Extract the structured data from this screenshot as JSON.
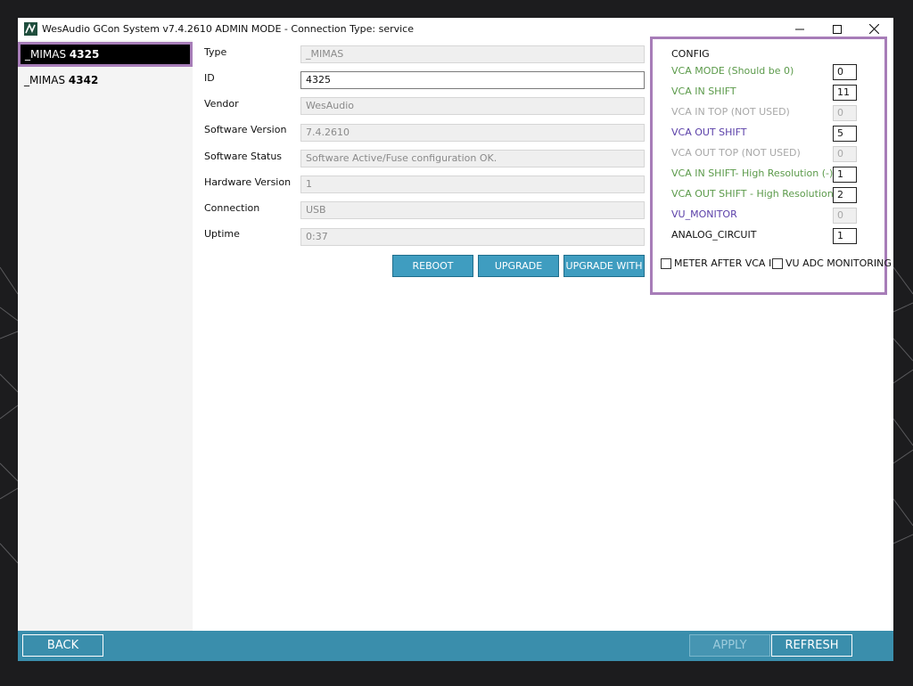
{
  "window": {
    "title": "WesAudio GCon System v7.4.2610 ADMIN MODE - Connection Type: service",
    "minimize_icon": "minimize-icon",
    "maximize_icon": "maximize-icon",
    "close_icon": "close-icon"
  },
  "sidebar": {
    "items": [
      {
        "prefix": "_MIMAS ",
        "id": "4325",
        "selected": true
      },
      {
        "prefix": "_MIMAS ",
        "id": "4342",
        "selected": false
      }
    ]
  },
  "info": {
    "fields": [
      {
        "label": "Type",
        "value": "_MIMAS",
        "editable": false
      },
      {
        "label": "ID",
        "value": "4325",
        "editable": true
      },
      {
        "label": "Vendor",
        "value": "WesAudio",
        "editable": false
      },
      {
        "label": "Software Version",
        "value": "7.4.2610",
        "editable": false
      },
      {
        "label": "Software Status",
        "value": "Software Active/Fuse configuration OK.",
        "editable": false
      },
      {
        "label": "Hardware Version",
        "value": "1",
        "editable": false
      },
      {
        "label": "Connection",
        "value": "USB",
        "editable": false
      },
      {
        "label": "Uptime",
        "value": "0:37",
        "editable": false
      }
    ],
    "buttons": {
      "reboot": "REBOOT",
      "upgrade": "UPGRADE",
      "upgrade_with": "UPGRADE WITH"
    }
  },
  "config": {
    "title": "CONFIG",
    "rows": [
      {
        "label": "VCA MODE (Should be 0)",
        "value": "0",
        "color": "#5b9a4a",
        "enabled": true
      },
      {
        "label": "VCA IN SHIFT",
        "value": "11",
        "color": "#5b9a4a",
        "enabled": true
      },
      {
        "label": "VCA IN TOP (NOT USED)",
        "value": "0",
        "color": "#a8a8a8",
        "enabled": false
      },
      {
        "label": "VCA OUT SHIFT",
        "value": "5",
        "color": "#5a3fa8",
        "enabled": true
      },
      {
        "label": "VCA OUT TOP (NOT USED)",
        "value": "0",
        "color": "#a8a8a8",
        "enabled": false
      },
      {
        "label": "VCA IN SHIFT- High Resolution (-)",
        "value": "1",
        "color": "#5b9a4a",
        "enabled": true
      },
      {
        "label": "VCA OUT SHIFT - High Resolution (-)",
        "value": "2",
        "color": "#5b9a4a",
        "enabled": true
      },
      {
        "label": "VU_MONITOR",
        "value": "0",
        "color": "#5a3fa8",
        "enabled": false
      },
      {
        "label": "ANALOG_CIRCUIT",
        "value": "1",
        "color": "#111111",
        "enabled": true
      }
    ],
    "checkboxes": {
      "meter_after_vca_in": "METER AFTER VCA IN",
      "vu_adc_monitoring": "VU ADC MONITORING"
    }
  },
  "bottom": {
    "back": "BACK",
    "apply": "APPLY",
    "refresh": "REFRESH"
  },
  "colors": {
    "accent": "#3f9dc0",
    "bottom_bar": "#3a8eac",
    "selection_border": "#a77db8"
  }
}
